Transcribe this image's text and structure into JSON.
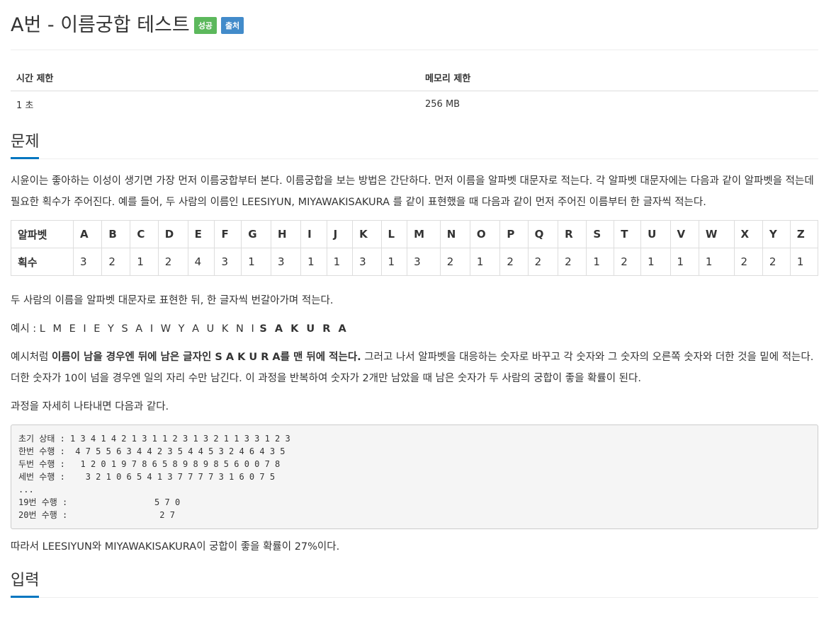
{
  "problem": {
    "title": "A번 - 이름궁합 테스트",
    "badges": {
      "success": "성공",
      "source": "출처"
    }
  },
  "limits": {
    "time_header": "시간 제한",
    "memory_header": "메모리 제한",
    "time_value": "1 초",
    "memory_value": "256 MB"
  },
  "section_problem": {
    "heading": "문제",
    "para1": "시윤이는 좋아하는 이성이 생기면 가장 먼저 이름궁합부터 본다. 이름궁합을 보는 방법은 간단하다. 먼저 이름을 알파벳 대문자로 적는다. 각 알파벳 대문자에는 다음과 같이 알파벳을 적는데 필요한 획수가 주어진다. 예를 들어, 두 사람의 이름인 LEESIYUN, MIYAWAKISAKURA 를 같이 표현했을 때 다음과 같이 먼저 주어진 이름부터 한 글자씩 적는다.",
    "table": {
      "row1_header": "알파벳",
      "row2_header": "획수",
      "letters": [
        "A",
        "B",
        "C",
        "D",
        "E",
        "F",
        "G",
        "H",
        "I",
        "J",
        "K",
        "L",
        "M",
        "N",
        "O",
        "P",
        "Q",
        "R",
        "S",
        "T",
        "U",
        "V",
        "W",
        "X",
        "Y",
        "Z"
      ],
      "strokes": [
        "3",
        "2",
        "1",
        "2",
        "4",
        "3",
        "1",
        "3",
        "1",
        "1",
        "3",
        "1",
        "3",
        "2",
        "1",
        "2",
        "2",
        "2",
        "1",
        "2",
        "1",
        "1",
        "1",
        "2",
        "2",
        "1"
      ]
    },
    "para2": "두 사람의 이름을 알파벳 대문자로 표현한 뒤, 한 글자씩 번갈아가며 적는다.",
    "example_label": "예시 :",
    "example_seq": "L M E I E Y S A I W Y A U K N I",
    "example_bold": "S A K U R A",
    "para3_lead": "예시처럼 ",
    "para3_bold": "이름이 남을 경우엔 뒤에 남은 글자인 S A K U R A를 맨 뒤에 적는다.",
    "para3_rest": " 그러고 나서 알파벳을 대응하는 숫자로 바꾸고 각 숫자와 그 숫자의 오른쪽 숫자와 더한 것을 밑에 적는다. 더한 숫자가 10이 넘을 경우엔 일의 자리 수만 남긴다. 이 과정을 반복하여 숫자가 2개만 남았을 때 남은 숫자가 두 사람의 궁합이 좋을 확률이 된다.",
    "para4": "과정을 자세히 나타내면 다음과 같다.",
    "code": "초기 상태 : 1 3 4 1 4 2 1 3 1 1 2 3 1 3 2 1 1 3 3 1 2 3\n한번 수행 :  4 7 5 5 6 3 4 4 2 3 5 4 4 5 3 2 4 6 4 3 5\n두번 수행 :   1 2 0 1 9 7 8 6 5 8 9 8 9 8 5 6 0 0 7 8\n세번 수행 :    3 2 1 0 6 5 4 1 3 7 7 7 7 3 1 6 0 7 5\n...\n19번 수행 :                 5 7 0\n20번 수행 :                  2 7",
    "para5": "따라서 LEESIYUN와 MIYAWAKISAKURA이 궁합이 좋을 확률이 27%이다."
  },
  "section_input": {
    "heading": "입력"
  }
}
